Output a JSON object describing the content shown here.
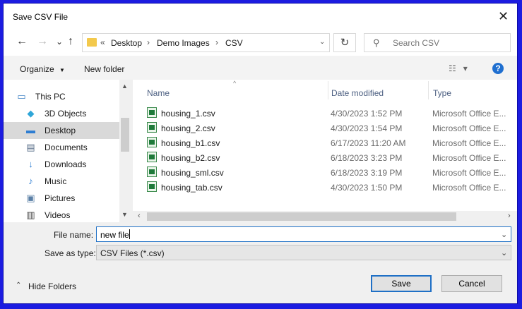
{
  "window": {
    "title": "Save CSV File"
  },
  "nav": {
    "back": "←",
    "forward": "→",
    "recent": "⌄",
    "up": "↑"
  },
  "address": {
    "overflow": "«",
    "segments": [
      "Desktop",
      "Demo Images",
      "CSV"
    ],
    "refresh": "↻"
  },
  "search": {
    "placeholder": "Search CSV"
  },
  "toolbar": {
    "organize": "Organize",
    "new_folder": "New folder",
    "help": "?"
  },
  "sidebar": {
    "items": [
      {
        "label": "This PC",
        "icon": "monitor-icon",
        "color": "#3b7fc4",
        "selected": false
      },
      {
        "label": "3D Objects",
        "icon": "cube-icon",
        "color": "#2fa6d8",
        "selected": false
      },
      {
        "label": "Desktop",
        "icon": "desktop-icon",
        "color": "#2d7dd2",
        "selected": true
      },
      {
        "label": "Documents",
        "icon": "document-icon",
        "color": "#5a6f8a",
        "selected": false
      },
      {
        "label": "Downloads",
        "icon": "download-icon",
        "color": "#2d7dd2",
        "selected": false
      },
      {
        "label": "Music",
        "icon": "music-icon",
        "color": "#2d7dd2",
        "selected": false
      },
      {
        "label": "Pictures",
        "icon": "pictures-icon",
        "color": "#5a7fa6",
        "selected": false
      },
      {
        "label": "Videos",
        "icon": "video-icon",
        "color": "#444444",
        "selected": false
      }
    ]
  },
  "files": {
    "columns": [
      "Name",
      "Date modified",
      "Type"
    ],
    "rows": [
      {
        "name": "housing_1.csv",
        "date": "4/30/2023 1:52 PM",
        "type": "Microsoft Office E..."
      },
      {
        "name": "housing_2.csv",
        "date": "4/30/2023 1:54 PM",
        "type": "Microsoft Office E..."
      },
      {
        "name": "housing_b1.csv",
        "date": "6/17/2023 11:20 AM",
        "type": "Microsoft Office E..."
      },
      {
        "name": "housing_b2.csv",
        "date": "6/18/2023 3:23 PM",
        "type": "Microsoft Office E..."
      },
      {
        "name": "housing_sml.csv",
        "date": "6/18/2023 3:19 PM",
        "type": "Microsoft Office E..."
      },
      {
        "name": "housing_tab.csv",
        "date": "4/30/2023 1:50 PM",
        "type": "Microsoft Office E..."
      }
    ]
  },
  "form": {
    "filename_label": "File name:",
    "filename_value": "new file",
    "savetype_label": "Save as type:",
    "savetype_value": "CSV Files (*.csv)"
  },
  "footer": {
    "hide_folders": "Hide Folders",
    "save": "Save",
    "cancel": "Cancel"
  },
  "colors": {
    "frame": "#1c1ce0",
    "accent": "#1f70c6",
    "selected_nav": "#d9d9d9"
  }
}
